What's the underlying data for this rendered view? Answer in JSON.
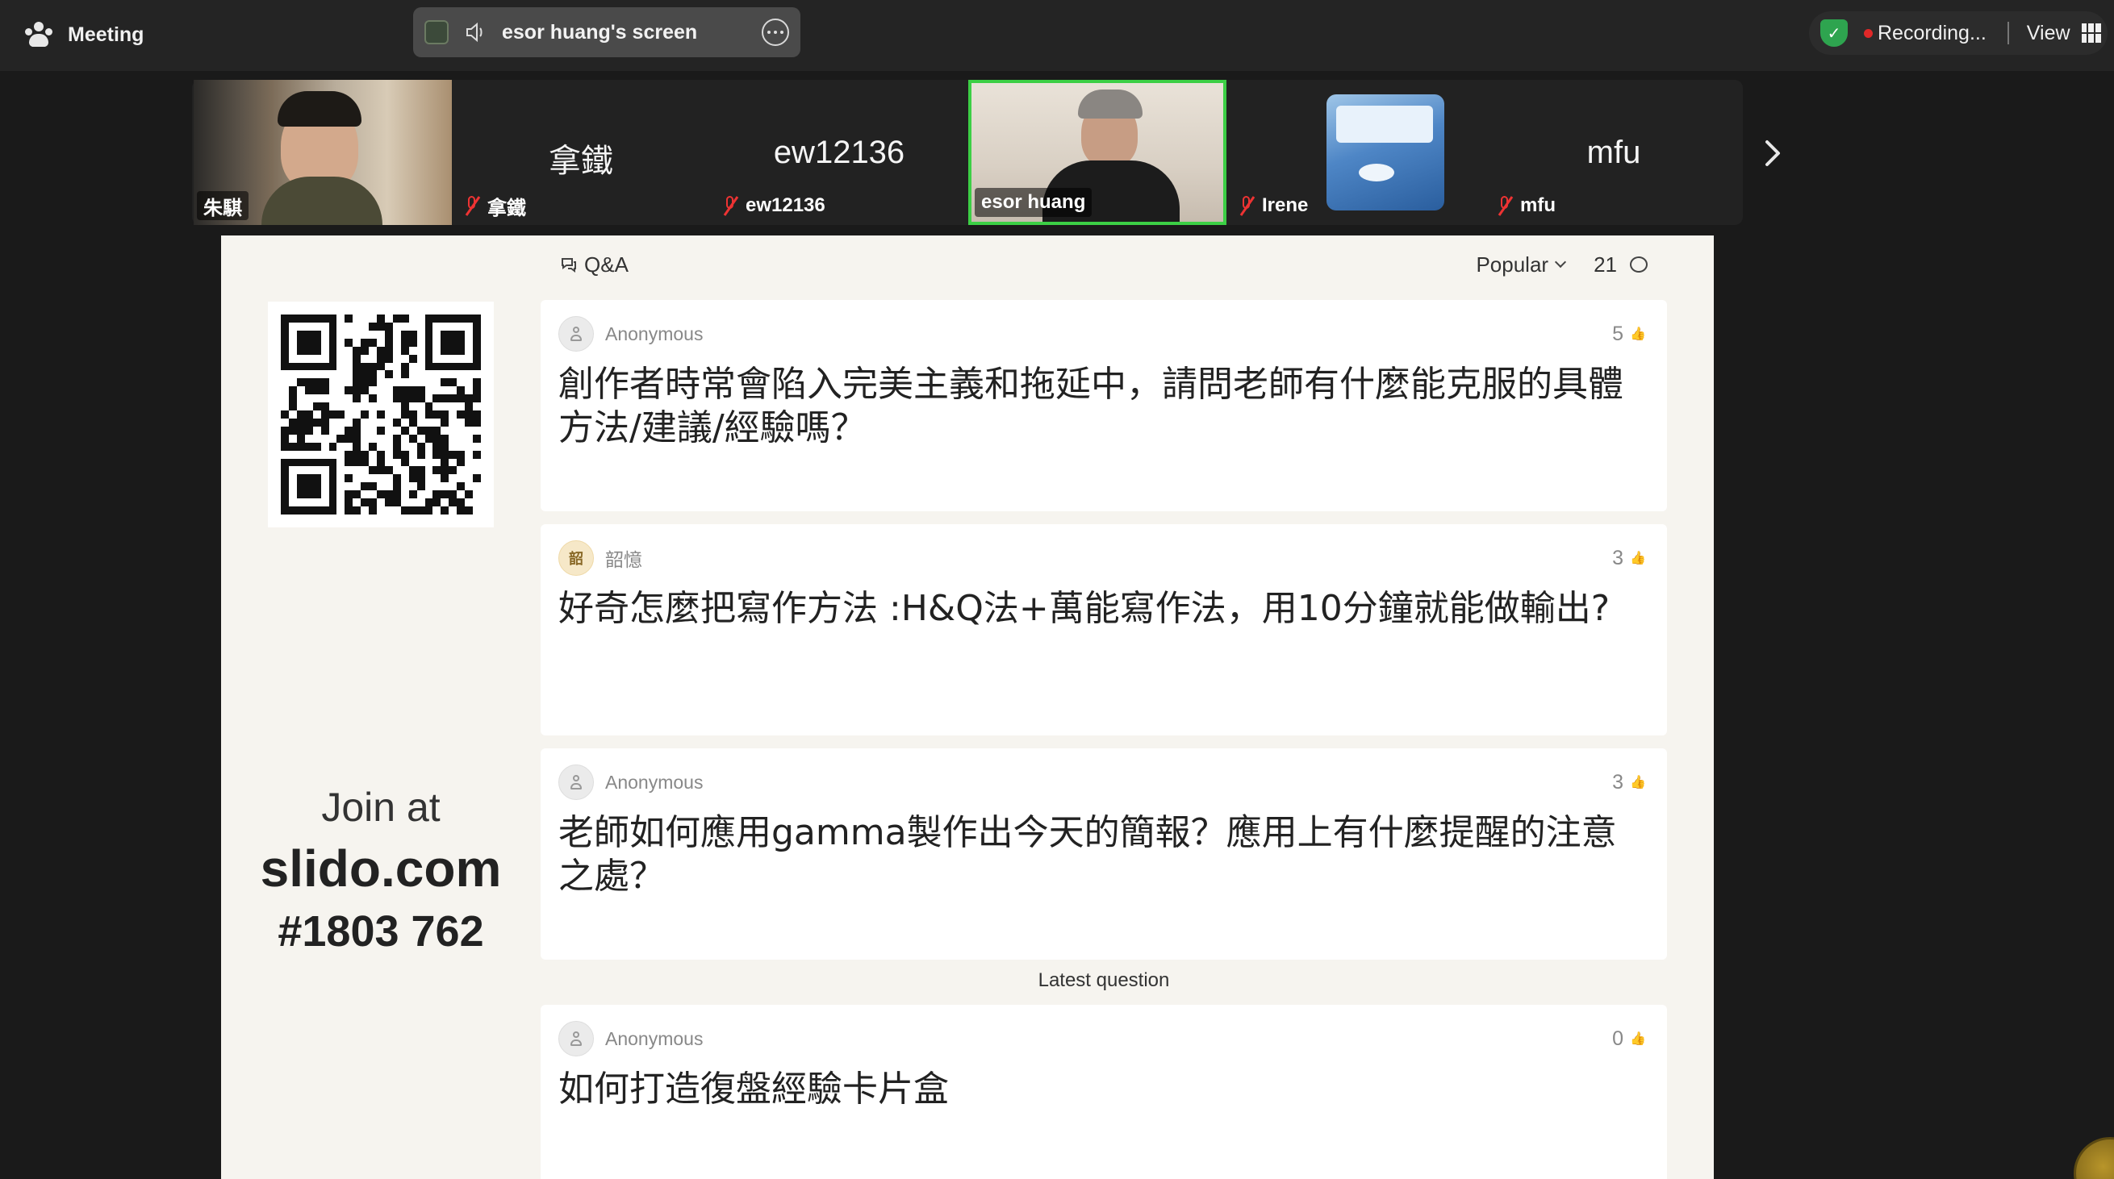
{
  "topbar": {
    "meeting_label": "Meeting",
    "share_label": "esor huang's screen",
    "recording_label": "Recording...",
    "view_label": "View"
  },
  "participants": [
    {
      "name": "朱騏",
      "type": "video"
    },
    {
      "name": "拿鐵",
      "center": "拿鐵",
      "type": "name"
    },
    {
      "name": "ew12136",
      "center": "ew12136",
      "type": "name"
    },
    {
      "name": "esor huang",
      "type": "video",
      "active": true
    },
    {
      "name": "Irene",
      "type": "image"
    },
    {
      "name": "mfu",
      "center": "mfu",
      "type": "name"
    }
  ],
  "slido": {
    "join_at": "Join at",
    "site": "slido.com",
    "code": "#1803 762",
    "qa_title": "Q&A",
    "sort_label": "Popular",
    "question_count": "21",
    "latest_label": "Latest question",
    "questions": [
      {
        "author": "Anonymous",
        "votes": "5",
        "text": "創作者時常會陷入完美主義和拖延中，請問老師有什麼能克服的具體方法/建議/經驗嗎？"
      },
      {
        "author": "韶憶",
        "avatar_char": "韶",
        "votes": "3",
        "text": "好奇怎麼把寫作方法 :H&Q法+萬能寫作法，用10分鐘就能做輸出?"
      },
      {
        "author": "Anonymous",
        "votes": "3",
        "text": "老師如何應用gamma製作出今天的簡報？應用上有什麼提醒的注意之處？"
      },
      {
        "author": "Anonymous",
        "votes": "0",
        "text": "如何打造復盤經驗卡片盒"
      }
    ]
  }
}
